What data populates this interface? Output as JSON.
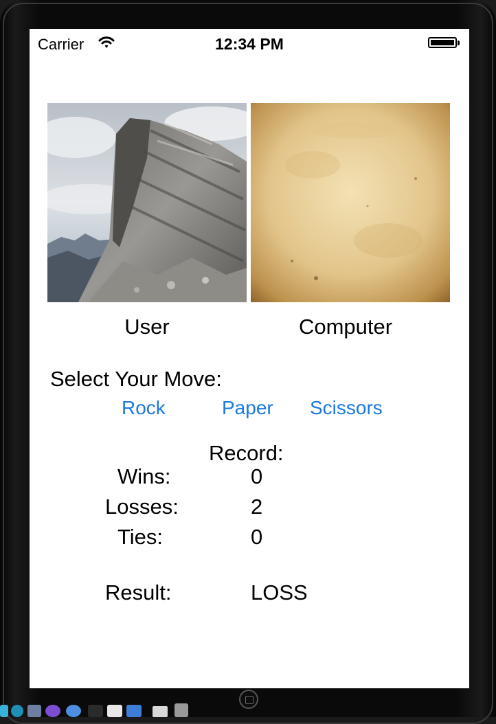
{
  "status": {
    "carrier": "Carrier",
    "time": "12:34 PM"
  },
  "images": {
    "user": {
      "label": "User",
      "move": "rock"
    },
    "computer": {
      "label": "Computer",
      "move": "paper"
    }
  },
  "moves": {
    "prompt": "Select Your Move:",
    "options": [
      "Rock",
      "Paper",
      "Scissors"
    ]
  },
  "record": {
    "title": "Record:",
    "wins_label": "Wins:",
    "wins": "0",
    "losses_label": "Losses:",
    "losses": "2",
    "ties_label": "Ties:",
    "ties": "0"
  },
  "result": {
    "label": "Result:",
    "value": "LOSS"
  },
  "colors": {
    "link": "#1a7ae0",
    "bezel": "#0a0a0a",
    "screen": "#ffffff"
  }
}
